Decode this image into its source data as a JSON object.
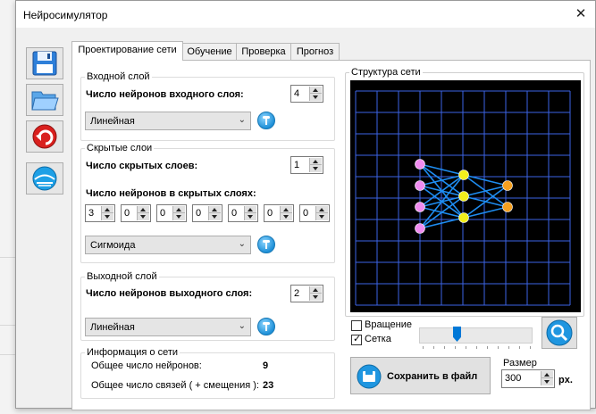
{
  "window": {
    "title": "Нейросимулятор",
    "close_glyph": "✕"
  },
  "toolbar": [
    {
      "icon": "floppy-save-icon"
    },
    {
      "icon": "folder-open-icon"
    },
    {
      "icon": "undo-arrow-icon"
    },
    {
      "icon": "globe-help-icon"
    }
  ],
  "tabs": [
    {
      "label": "Проектирование сети",
      "active": true
    },
    {
      "label": "Обучение",
      "active": false
    },
    {
      "label": "Проверка",
      "active": false
    },
    {
      "label": "Прогноз",
      "active": false
    }
  ],
  "input_layer": {
    "legend": "Входной слой",
    "neurons_label": "Число нейронов входного слоя:",
    "neurons": "4",
    "activation": "Линейная"
  },
  "hidden_layers": {
    "legend": "Скрытые слои",
    "count_label": "Число скрытых слоев:",
    "count": "1",
    "neurons_label": "Число нейронов в скрытых слоях:",
    "neurons": [
      "3",
      "0",
      "0",
      "0",
      "0",
      "0",
      "0"
    ],
    "activation": "Сигмоида"
  },
  "output_layer": {
    "legend": "Выходной слой",
    "neurons_label": "Число нейронов выходного слоя:",
    "neurons": "2",
    "activation": "Линейная"
  },
  "info": {
    "legend": "Информация о сети",
    "total_neurons_label": "Общее число нейронов:",
    "total_neurons": "9",
    "total_links_label": "Общее число связей  ( + смещения ):",
    "total_links": "23"
  },
  "structure": {
    "legend": "Структура сети",
    "colors": {
      "background": "#000000",
      "grid": "#3c64e6",
      "input": "#f08cf0",
      "hidden": "#f2ef1c",
      "output": "#f5a020",
      "links": "#1e8cf0"
    },
    "rotation_label": "Вращение",
    "rotation_checked": false,
    "grid_label": "Сетка",
    "grid_checked": true,
    "save_label": "Сохранить в файл",
    "size_label": "Размер",
    "size_value": "300",
    "size_unit": "px."
  }
}
